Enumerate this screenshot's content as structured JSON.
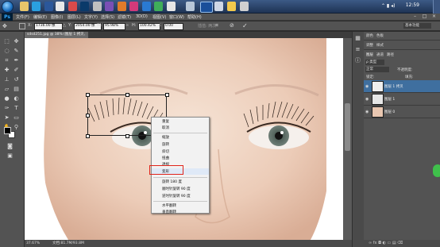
{
  "taskbar": {
    "clock": "12:59",
    "apps": [
      "explorer",
      "qq",
      "word",
      "browser",
      "chat",
      "ps",
      "network",
      "app-a",
      "app-b",
      "app-c",
      "app-d",
      "app-e",
      "ps-active",
      "app-f",
      "app-g",
      "app-h"
    ]
  },
  "app": {
    "logo": "Ps",
    "menus": [
      "文件(F)",
      "编辑(E)",
      "图像(I)",
      "图层(L)",
      "文字(Y)",
      "选择(S)",
      "滤镜(T)",
      "3D(D)",
      "视图(V)",
      "窗口(W)",
      "帮助(H)"
    ]
  },
  "options": {
    "x_label": "X:",
    "x_value": "1736.00 像",
    "y_label": "Y:",
    "y_value": "2054.00 像",
    "w_label": "W:",
    "w_value": "95.98%",
    "h_label": "H:",
    "h_value": "100.42%",
    "angle_value": "0.00",
    "interp_label": "插值: 两次",
    "workspace_label": "基本功能"
  },
  "document": {
    "tab_title": "sdsd251.jpg @ 38% (图层 1 拷贝, RGB/8) *",
    "zoom": "37.67%",
    "doc_size": "文档:81.7M/93.8M"
  },
  "panels": {
    "top_tabs": [
      "颜色",
      "色板"
    ],
    "adjust_tabs": [
      "调整",
      "样式"
    ],
    "layers_tabs": [
      "图层",
      "通道",
      "路径"
    ],
    "kind_label": "ρ 类型",
    "blend_mode": "正常",
    "opacity_label": "不透明度:",
    "lock_label": "锁定:",
    "fill_label": "填充:",
    "layers": [
      {
        "name": "图层 1 拷贝",
        "active": true
      },
      {
        "name": "图层 1",
        "active": false
      },
      {
        "name": "图层 0",
        "active": false
      }
    ]
  },
  "context_menu": {
    "items": [
      "重复",
      "取消",
      "缩放",
      "旋转",
      "斜切",
      "扭曲",
      "透视",
      "变形",
      "旋转 180 度",
      "顺时针旋转 90 度",
      "逆时针旋转 90 度",
      "水平翻转",
      "垂直翻转"
    ],
    "highlighted": "变形"
  },
  "colors": {
    "highlight_box": "#e0241b",
    "ps_blue": "#31a8ff"
  }
}
